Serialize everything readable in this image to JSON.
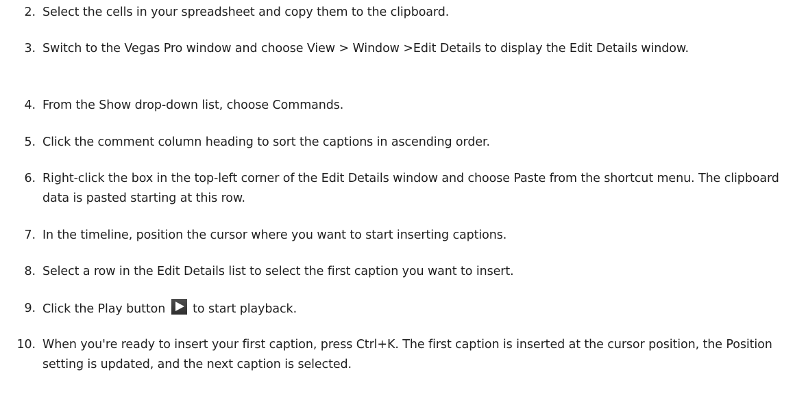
{
  "steps": [
    {
      "num": "2.",
      "before": "Select the cells in your spreadsheet and copy them to the clipboard."
    },
    {
      "num": "3.",
      "before": "Switch to the Vegas Pro window and choose View > Window >Edit Details to display the Edit Details window."
    },
    {
      "num": "4.",
      "before": "From the Show drop-down list, choose Commands."
    },
    {
      "num": "5.",
      "before": "Click the comment column heading to sort the captions in ascending order."
    },
    {
      "num": "6.",
      "before": "Right-click the box in the top-left corner of the Edit Details window and choose Paste from the shortcut menu. The clipboard data is pasted starting at this row."
    },
    {
      "num": "7.",
      "before": "In the timeline, position the cursor where you want to start inserting captions."
    },
    {
      "num": "8.",
      "before": "Select a row in the Edit Details list to select the first caption you want to insert."
    },
    {
      "num": "9.",
      "before": "Click the Play button",
      "after": "to start playback.",
      "icon": "play-icon"
    },
    {
      "num": "10.",
      "before": "When you're ready to insert your first caption, press Ctrl+K. The first caption is inserted at the cursor position, the Position setting is updated, and the next caption is selected."
    }
  ]
}
